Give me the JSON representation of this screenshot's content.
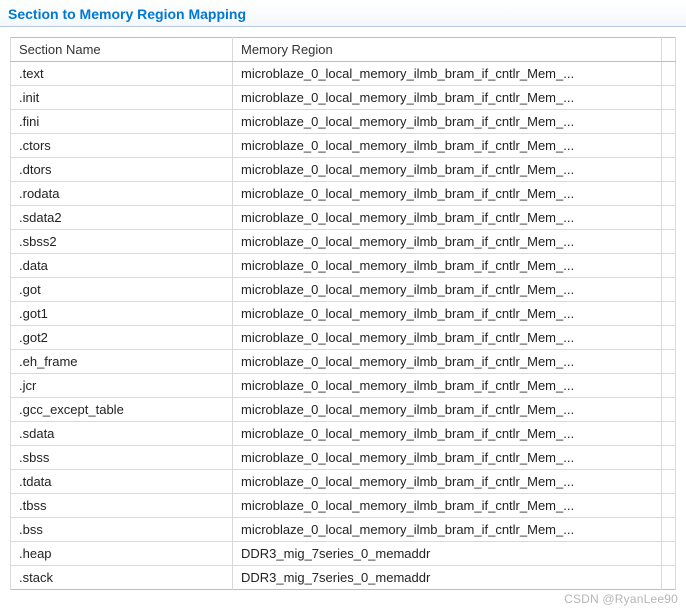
{
  "title": "Section to Memory Region Mapping",
  "columns": [
    "Section Name",
    "Memory Region"
  ],
  "rows": [
    {
      "section": ".text",
      "region": "microblaze_0_local_memory_ilmb_bram_if_cntlr_Mem_..."
    },
    {
      "section": ".init",
      "region": "microblaze_0_local_memory_ilmb_bram_if_cntlr_Mem_..."
    },
    {
      "section": ".fini",
      "region": "microblaze_0_local_memory_ilmb_bram_if_cntlr_Mem_..."
    },
    {
      "section": ".ctors",
      "region": "microblaze_0_local_memory_ilmb_bram_if_cntlr_Mem_..."
    },
    {
      "section": ".dtors",
      "region": "microblaze_0_local_memory_ilmb_bram_if_cntlr_Mem_..."
    },
    {
      "section": ".rodata",
      "region": "microblaze_0_local_memory_ilmb_bram_if_cntlr_Mem_..."
    },
    {
      "section": ".sdata2",
      "region": "microblaze_0_local_memory_ilmb_bram_if_cntlr_Mem_..."
    },
    {
      "section": ".sbss2",
      "region": "microblaze_0_local_memory_ilmb_bram_if_cntlr_Mem_..."
    },
    {
      "section": ".data",
      "region": "microblaze_0_local_memory_ilmb_bram_if_cntlr_Mem_..."
    },
    {
      "section": ".got",
      "region": "microblaze_0_local_memory_ilmb_bram_if_cntlr_Mem_..."
    },
    {
      "section": ".got1",
      "region": "microblaze_0_local_memory_ilmb_bram_if_cntlr_Mem_..."
    },
    {
      "section": ".got2",
      "region": "microblaze_0_local_memory_ilmb_bram_if_cntlr_Mem_..."
    },
    {
      "section": ".eh_frame",
      "region": "microblaze_0_local_memory_ilmb_bram_if_cntlr_Mem_..."
    },
    {
      "section": ".jcr",
      "region": "microblaze_0_local_memory_ilmb_bram_if_cntlr_Mem_..."
    },
    {
      "section": ".gcc_except_table",
      "region": "microblaze_0_local_memory_ilmb_bram_if_cntlr_Mem_..."
    },
    {
      "section": ".sdata",
      "region": "microblaze_0_local_memory_ilmb_bram_if_cntlr_Mem_..."
    },
    {
      "section": ".sbss",
      "region": "microblaze_0_local_memory_ilmb_bram_if_cntlr_Mem_..."
    },
    {
      "section": ".tdata",
      "region": "microblaze_0_local_memory_ilmb_bram_if_cntlr_Mem_..."
    },
    {
      "section": ".tbss",
      "region": "microblaze_0_local_memory_ilmb_bram_if_cntlr_Mem_..."
    },
    {
      "section": ".bss",
      "region": "microblaze_0_local_memory_ilmb_bram_if_cntlr_Mem_..."
    },
    {
      "section": ".heap",
      "region": "DDR3_mig_7series_0_memaddr"
    },
    {
      "section": ".stack",
      "region": "DDR3_mig_7series_0_memaddr"
    }
  ],
  "watermark": "CSDN @RyanLee90"
}
